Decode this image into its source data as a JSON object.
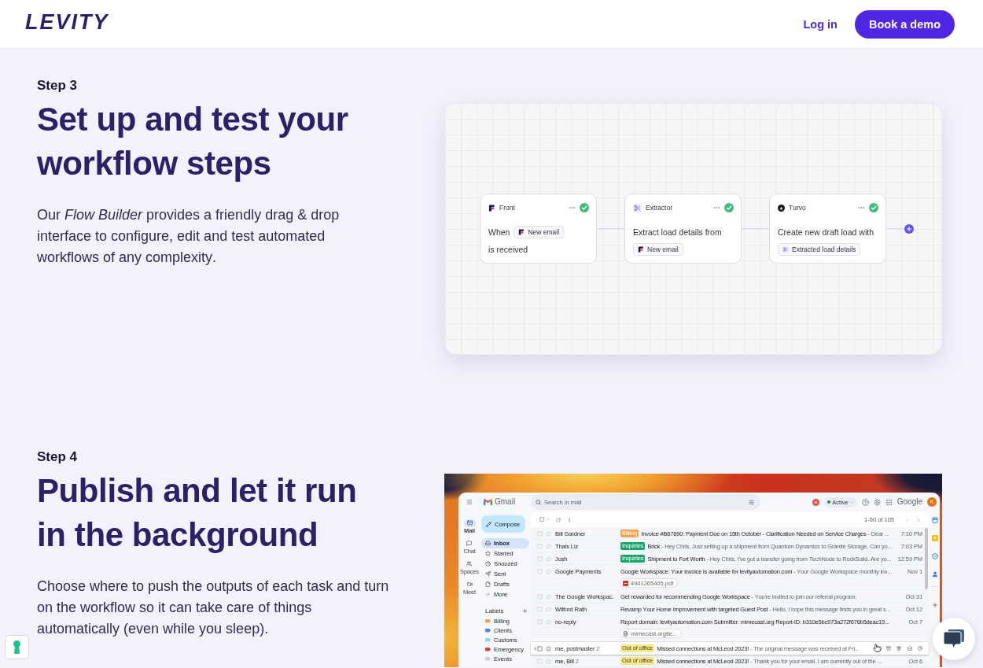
{
  "header": {
    "logo": "LEVITY",
    "login": "Log in",
    "cta": "Book a demo"
  },
  "steps": [
    {
      "step": "Step 3",
      "title": "Set up and test your workflow steps",
      "description": "Our *Flow Builder* provides a friendly drag & drop interface to configure, edit and test automated workflows of any complexity.",
      "visual": {
        "kind": "flow",
        "nodes": [
          {
            "kind": "front",
            "app": "Front",
            "done": true,
            "text": "When",
            "chip": {
              "kind": "front",
              "label": "New email"
            },
            "text_after": "is received"
          },
          {
            "kind": "extractor",
            "app": "Extractor",
            "done": true,
            "text": "Extract load details from",
            "chip": {
              "kind": "front",
              "label": "New email"
            }
          },
          {
            "kind": "turvo",
            "app": "Turvo",
            "done": true,
            "text": "Create new draft load with",
            "chip": {
              "kind": "extractor",
              "label": "Extracted load details"
            }
          }
        ]
      }
    },
    {
      "step": "Step 4",
      "title": "Publish and let it run in the background",
      "description": "Choose where to push the outputs of each task and turn on the workflow so it can take care of things automatically (even while you sleep).",
      "visual": {
        "kind": "gmail",
        "app_name": "Gmail",
        "search": {
          "placeholder": "Search in mail"
        },
        "status": "Active",
        "account": "Google",
        "avatar": "K",
        "rail": [
          {
            "kind": "mail",
            "label": "Mail",
            "selected": true
          },
          {
            "kind": "chat",
            "label": "Chat",
            "selected": false
          },
          {
            "kind": "spaces",
            "label": "Spaces",
            "selected": false
          },
          {
            "kind": "meet",
            "label": "Meet",
            "selected": false
          }
        ],
        "compose": "Compose",
        "folders": [
          {
            "kind": "inbox",
            "label": "Inbox",
            "selected": true
          },
          {
            "kind": "starred",
            "label": "Starred",
            "selected": false
          },
          {
            "kind": "snoozed",
            "label": "Snoozed",
            "selected": false
          },
          {
            "kind": "sent",
            "label": "Sent",
            "selected": false
          },
          {
            "kind": "drafts",
            "label": "Drafts",
            "selected": false
          },
          {
            "kind": "more",
            "label": "More",
            "selected": false
          }
        ],
        "labels_title": "Labels",
        "labels": [
          {
            "name": "Billing",
            "color": "#f6a24e"
          },
          {
            "name": "Clients",
            "color": "#4a86e8"
          },
          {
            "name": "Customs",
            "color": "#8fd7dc"
          },
          {
            "name": "Emergency",
            "color": "#e03c3c"
          },
          {
            "name": "Events",
            "color": "#cfcfcf"
          }
        ],
        "pagination": "1-50 of 105",
        "emails": [
          {
            "sender": "Bill Gardner",
            "tag": {
              "text": "Billing",
              "color": "#f6a24e"
            },
            "subject": "Invoice #B67890: Payment Due on 15th October - Clarification Needed on Service Charges",
            "snippet": "- Dear ...",
            "date": "7:10 PM",
            "hovered": false
          },
          {
            "sender": "Thais Liz",
            "tag": {
              "text": "Inquiries",
              "color": "#16a766"
            },
            "subject": "Brick",
            "snippet": "- Hey Chris, Just setting up a shipment from Quantum Dynamics to Granite Storage. Can yo...",
            "date": "7:03 PM",
            "hovered": false
          },
          {
            "sender": "Josh",
            "tag": {
              "text": "Inquiries",
              "color": "#16a766"
            },
            "subject": "Shipment to Fort Worth",
            "snippet": "- Hey Chris, I've got a transfer going from TechNode to RockSolid. Are yo...",
            "date": "12:59 PM",
            "hovered": false
          },
          {
            "sender": "Google Payments",
            "subject": "Google Workspace: Your invoice is available for levityautomation.com",
            "snippet": "- Your Google Workspace monthly inv...",
            "date": "Nov 1",
            "hovered": false,
            "attachment": {
              "kind": "pdf",
              "name": "4941265405.pdf"
            }
          },
          {
            "sender": "The Google Workspac.",
            "subject": "Get rewarded for recommending Google Workspace",
            "snippet": "- You're invited to join our referral program.",
            "date": "Oct 31",
            "hovered": false
          },
          {
            "sender": "Wilford Rath",
            "subject": "Revamp Your Home Improvement with targeted Guest Post",
            "snippet": "- Hello, I hope this message finds you in great s...",
            "date": "Oct 12",
            "hovered": false
          },
          {
            "sender": "no-reply",
            "subject": "Report domain: levityautomation.com Submitter: mimecast.org Report-ID: b310e5bc973a272f676b5deac19...",
            "date": "Oct 7",
            "hovered": false,
            "attachment": {
              "kind": "doc",
              "name": "mimecast.orgtle..."
            }
          },
          {
            "sender": "me, postmaster",
            "count": "2",
            "tag": {
              "text": "Out of office",
              "color": "#fbe983"
            },
            "subject": "Missed connections at McLeod 2023!",
            "snippet": "- The original message was received at Fri...",
            "hovered": true
          },
          {
            "sender": "me, Bill",
            "count": "2",
            "tag": {
              "text": "Out of office",
              "color": "#fbe983"
            },
            "subject": "Missed connections at McLeod 2023!",
            "snippet": "- Thank you for your email. I am currently out of the ...",
            "date": "Oct 6",
            "hovered": false
          }
        ]
      }
    }
  ]
}
